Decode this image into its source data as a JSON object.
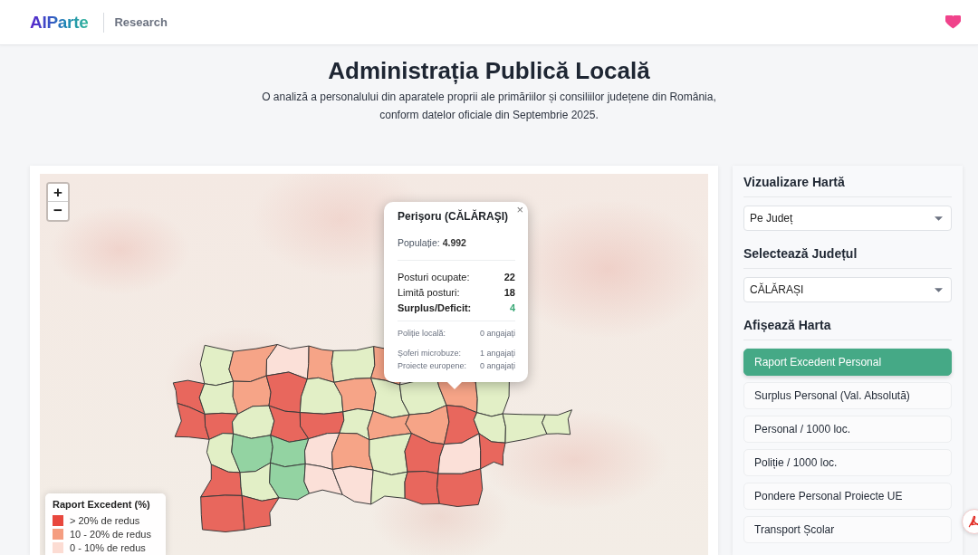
{
  "header": {
    "logo": "AIParte",
    "section": "Research"
  },
  "intro": {
    "title": "Administrația Publică Locală",
    "subtitle": "O analiză a personalului din aparatele proprii ale primăriilor și consiliilor județene din România, conform datelor oficiale din Septembrie 2025."
  },
  "map": {
    "zoom_controls": [
      "+",
      "−"
    ],
    "popup": {
      "title": "Perişoru (CĂLĂRAŞI)",
      "close": "×",
      "population": "Populație: **4.992**",
      "stats": [
        {
          "label": "Posturi ocupate:",
          "value": "22",
          "kind": "count"
        },
        {
          "label": "Limită posturi:",
          "value": "18",
          "kind": "count"
        },
        {
          "label": "Surplus/Deficit:",
          "value": "4",
          "kind": "total"
        }
      ],
      "staff": [
        {
          "label": "Poliție locală:",
          "value": "0 angajați"
        },
        {
          "label": "Șoferi microbuze:",
          "value": "1 angajați"
        },
        {
          "label": "Proiecte europene:",
          "value": "0 angajați"
        }
      ]
    },
    "legend": {
      "title": "Raport Excedent (%)",
      "items": [
        {
          "label": "> 20% de redus",
          "color": "#e8473d"
        },
        {
          "label": "10 - 20% de redus",
          "color": "#f59d80"
        },
        {
          "label": "0 - 10% de redus",
          "color": "#fcdcd3"
        }
      ]
    }
  },
  "sidebar": {
    "sections": [
      {
        "heading": "Vizualizare Hartă",
        "kind": "select",
        "value": "Pe Județ"
      },
      {
        "heading": "Selectează Județul",
        "kind": "select",
        "value": "CĂLĂRAȘI"
      },
      {
        "heading": "Afișează Harta",
        "kind": "options",
        "options": [
          {
            "label": "Raport Excedent Personal",
            "selected": true
          },
          {
            "label": "Surplus Personal (Val. Absolută)",
            "selected": false
          },
          {
            "label": "Personal / 1000 loc.",
            "selected": false
          },
          {
            "label": "Poliție / 1000 loc.",
            "selected": false
          },
          {
            "label": "Pondere Personal Proiecte UE",
            "selected": false
          },
          {
            "label": "Transport Școlar",
            "selected": false
          }
        ]
      }
    ]
  }
}
